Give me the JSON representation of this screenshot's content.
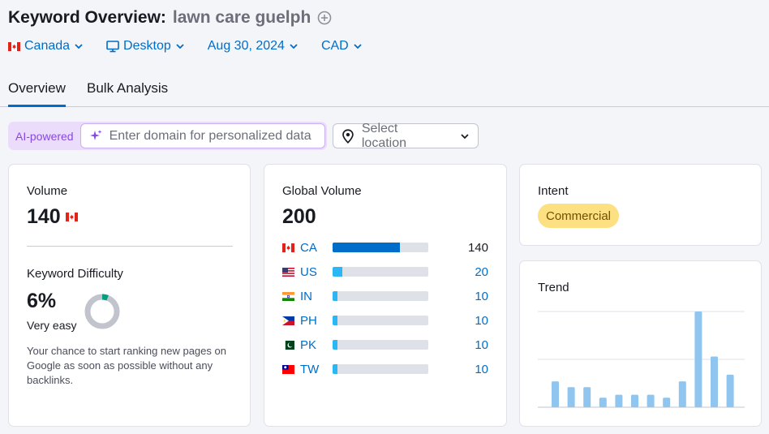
{
  "header": {
    "title": "Keyword Overview:",
    "keyword": "lawn care guelph"
  },
  "filters": {
    "country": "Canada",
    "device": "Desktop",
    "date": "Aug 30, 2024",
    "currency": "CAD"
  },
  "tabs": [
    {
      "label": "Overview",
      "active": true
    },
    {
      "label": "Bulk Analysis",
      "active": false
    }
  ],
  "personalize": {
    "badge": "AI-powered",
    "domain_placeholder": "Enter domain for personalized data",
    "location_placeholder": "Select location"
  },
  "volume": {
    "label": "Volume",
    "value": "140"
  },
  "difficulty": {
    "label": "Keyword Difficulty",
    "value": "6%",
    "percent": 6,
    "level": "Very easy",
    "description": "Your chance to start ranking new pages on Google as soon as possible without any backlinks."
  },
  "global_volume": {
    "label": "Global Volume",
    "value": "200",
    "max": 200,
    "countries": [
      {
        "code": "CA",
        "value": 140,
        "flag": "flag-canada",
        "bar_color": "#006dca",
        "value_color": "#191b23"
      },
      {
        "code": "US",
        "value": 20,
        "flag": "flag-usa",
        "bar_color": "#2bb7f3",
        "value_color": "#006dca"
      },
      {
        "code": "IN",
        "value": 10,
        "flag": "flag-india",
        "bar_color": "#2bb7f3",
        "value_color": "#006dca"
      },
      {
        "code": "PH",
        "value": 10,
        "flag": "flag-philippines",
        "bar_color": "#2bb7f3",
        "value_color": "#006dca"
      },
      {
        "code": "PK",
        "value": 10,
        "flag": "flag-pakistan",
        "bar_color": "#2bb7f3",
        "value_color": "#006dca"
      },
      {
        "code": "TW",
        "value": 10,
        "flag": "flag-taiwan",
        "bar_color": "#2bb7f3",
        "value_color": "#006dca"
      }
    ]
  },
  "intent": {
    "label": "Intent",
    "value": "Commercial"
  },
  "trend": {
    "label": "Trend",
    "chart_data": {
      "type": "bar",
      "values": [
        27,
        21,
        21,
        10,
        13,
        13,
        13,
        10,
        27,
        100,
        53,
        34
      ],
      "ylim": [
        0,
        100
      ],
      "grid": true
    }
  },
  "colors": {
    "accent": "#006dca",
    "ai_purple": "#8649e1",
    "intent_bg": "#fce081",
    "kd_green": "#009f81",
    "kd_gray": "#c1c4cd",
    "trend_bar": "#8fc5ee"
  }
}
